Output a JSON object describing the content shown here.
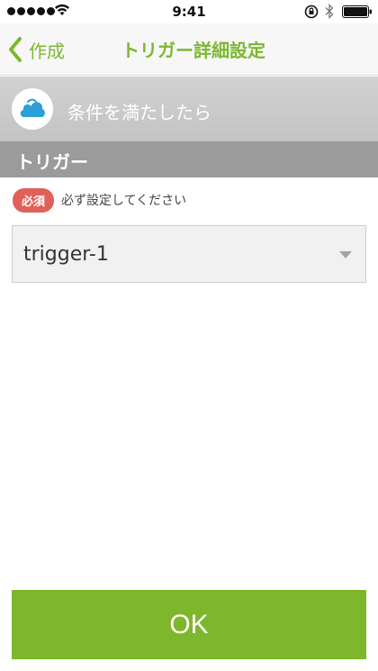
{
  "status_bar": {
    "time": "9:41",
    "signal_dots": 5,
    "icons": [
      "wifi-icon",
      "rotation-lock-icon",
      "bluetooth-icon",
      "battery-icon"
    ],
    "battery_level": 1.0
  },
  "nav": {
    "back_label": "作成",
    "title": "トリガー詳細設定",
    "accent_color": "#7cb82f"
  },
  "condition": {
    "icon": "cloud-icon",
    "label": "条件を満たしたら"
  },
  "section": {
    "title": "トリガー"
  },
  "required": {
    "badge": "必須",
    "text": "必ず設定してください",
    "badge_color": "#e0605a"
  },
  "trigger_select": {
    "value": "trigger-1"
  },
  "ok_button": {
    "label": "OK",
    "color": "#7eb72c"
  }
}
